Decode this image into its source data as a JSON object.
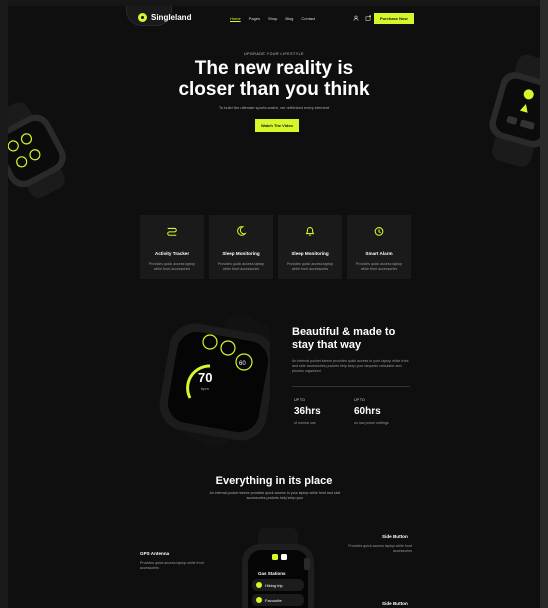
{
  "header": {
    "logo": "Singleland",
    "nav": [
      "Home",
      "Pages",
      "Shop",
      "Blog",
      "Contact"
    ],
    "purchase_label": "Purchase Now"
  },
  "hero": {
    "eyebrow": "UPGRADE YOUR LIFESTYLE",
    "title_line1": "The new reality is",
    "title_line2": "closer than you think",
    "subtitle": "To build the ultimate sports watch, we rethinked every element",
    "cta_label": "Watch The Video"
  },
  "features": [
    {
      "title": "Activity Tracker",
      "desc": "Provides quick access laptop while front accessories"
    },
    {
      "title": "Sleep Monitoring",
      "desc": "Provides quick access laptop while front accessories"
    },
    {
      "title": "Sleep Monitoring",
      "desc": "Provides quick access laptop while front accessories"
    },
    {
      "title": "Smart Alarm",
      "desc": "Provides quick access laptop while front accessories"
    }
  ],
  "beautiful": {
    "title_line1": "Beautiful & made to",
    "title_line2": "stay that way",
    "text": "An internal pocket sleeve provides quick access to your laptop while front and side accessories pockets help keep your lanyards calculator and phones organized",
    "watch_value": "70",
    "watch_unit": "bpm",
    "watch_small": "60",
    "stats": [
      {
        "label": "UP TO",
        "value": "36hrs",
        "desc": "of normal use"
      },
      {
        "label": "UP TO",
        "value": "60hrs",
        "desc": "on low power settings"
      }
    ]
  },
  "everything": {
    "title": "Everything in its place",
    "subtitle": "An internal pocket sleeve provides quick access to your laptop while front and side accessories pockets help keep your",
    "gps_title": "GPS Antenna",
    "gps_desc": "Provides quick access laptop while front accessories",
    "side_title": "Side Button",
    "side_desc": "Provides quick access laptop while front accessories",
    "side_title2": "Side Button",
    "watch_header": "Gas Stations",
    "watch_item1": "Hiking trip",
    "watch_item2": "Favourite"
  },
  "colors": {
    "accent": "#d4f82a",
    "bg": "#0f0f0f",
    "card": "#1a1a1a"
  }
}
